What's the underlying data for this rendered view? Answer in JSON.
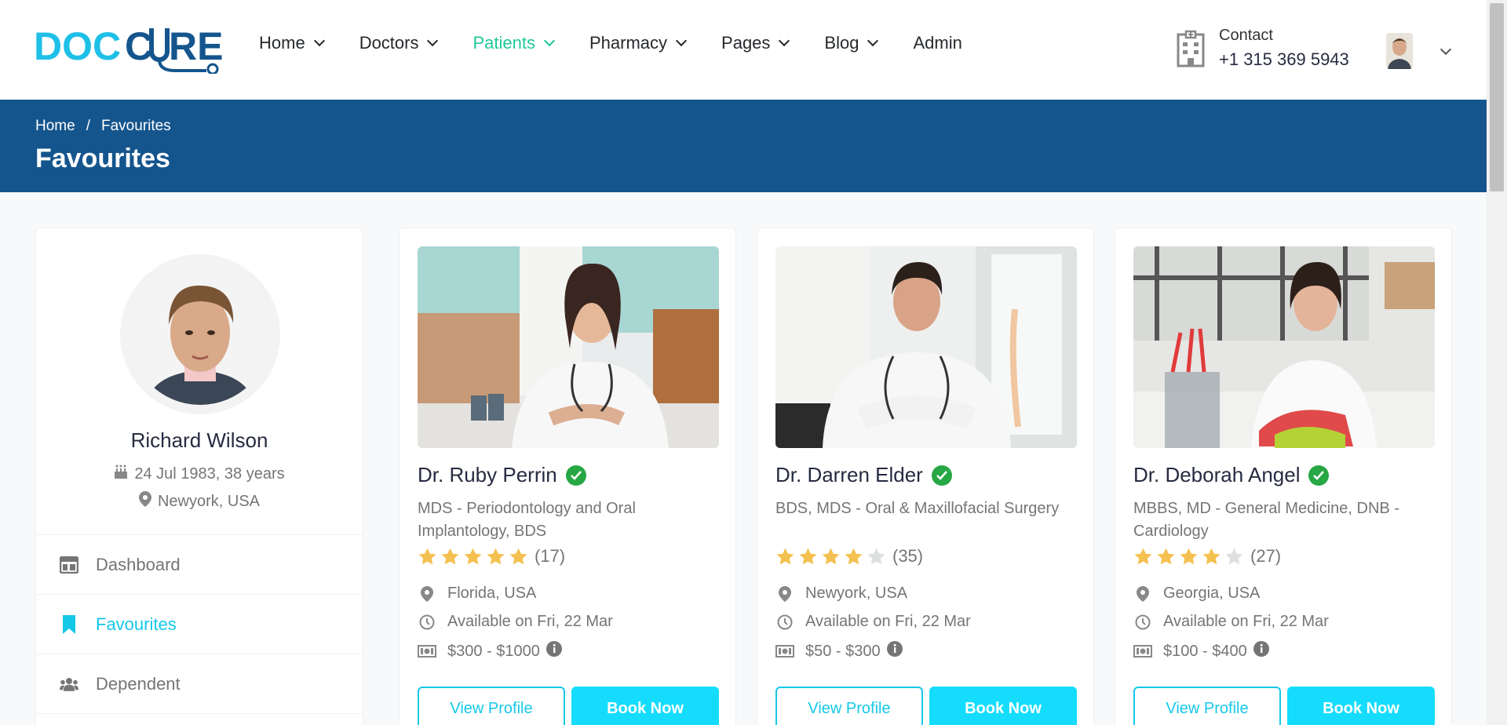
{
  "header": {
    "logo": "DOCCURE",
    "nav": [
      {
        "label": "Home",
        "has_dropdown": true,
        "active": false
      },
      {
        "label": "Doctors",
        "has_dropdown": true,
        "active": false
      },
      {
        "label": "Patients",
        "has_dropdown": true,
        "active": true
      },
      {
        "label": "Pharmacy",
        "has_dropdown": true,
        "active": false
      },
      {
        "label": "Pages",
        "has_dropdown": true,
        "active": false
      },
      {
        "label": "Blog",
        "has_dropdown": true,
        "active": false
      },
      {
        "label": "Admin",
        "has_dropdown": false,
        "active": false
      }
    ],
    "contact_label": "Contact",
    "contact_phone": "+1 315 369 5943"
  },
  "breadcrumb": {
    "items": [
      "Home",
      "Favourites"
    ],
    "separator": "/",
    "page_title": "Favourites"
  },
  "sidebar": {
    "name": "Richard Wilson",
    "dob": "24 Jul 1983, 38 years",
    "location": "Newyork, USA",
    "menu": [
      {
        "label": "Dashboard",
        "icon": "dashboard-icon",
        "active": false
      },
      {
        "label": "Favourites",
        "icon": "bookmark-icon",
        "active": true
      },
      {
        "label": "Dependent",
        "icon": "users-icon",
        "active": false
      }
    ]
  },
  "doctors": [
    {
      "name": "Dr. Ruby Perrin",
      "speciality": "MDS - Periodontology and Oral Implantology, BDS",
      "rating": 5,
      "reviews": "(17)",
      "location": "Florida, USA",
      "availability": "Available on Fri, 22 Mar",
      "price": "$300 - $1000",
      "view_label": "View Profile",
      "book_label": "Book Now"
    },
    {
      "name": "Dr. Darren Elder",
      "speciality": "BDS, MDS - Oral & Maxillofacial Surgery",
      "rating": 4,
      "reviews": "(35)",
      "location": "Newyork, USA",
      "availability": "Available on Fri, 22 Mar",
      "price": "$50 - $300",
      "view_label": "View Profile",
      "book_label": "Book Now"
    },
    {
      "name": "Dr. Deborah Angel",
      "speciality": "MBBS, MD - General Medicine, DNB - Cardiology",
      "rating": 4,
      "reviews": "(27)",
      "location": "Georgia, USA",
      "availability": "Available on Fri, 22 Mar",
      "price": "$100 - $400",
      "view_label": "View Profile",
      "book_label": "Book Now"
    }
  ],
  "colors": {
    "brand_blue": "#15558d",
    "accent_cyan": "#15c8e8",
    "active_green": "#20c997",
    "star": "#f4c150",
    "verified": "#28a745"
  }
}
